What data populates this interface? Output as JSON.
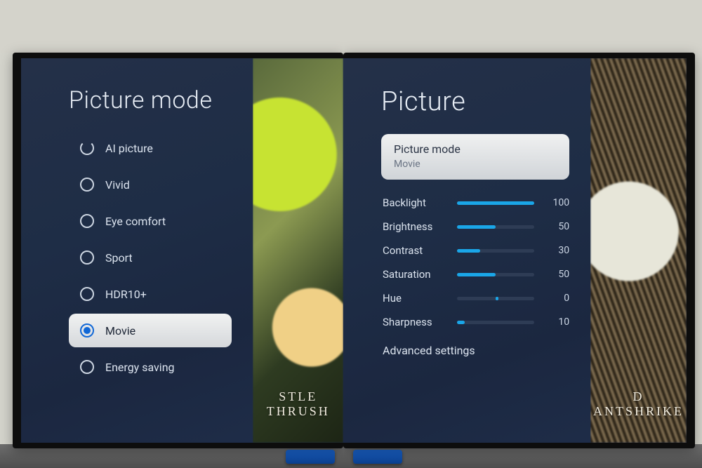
{
  "left_screen": {
    "title": "Picture mode",
    "options": [
      {
        "label": "AI picture",
        "selected": false,
        "clipped": true
      },
      {
        "label": "Vivid",
        "selected": false
      },
      {
        "label": "Eye comfort",
        "selected": false
      },
      {
        "label": "Sport",
        "selected": false
      },
      {
        "label": "HDR10+",
        "selected": false
      },
      {
        "label": "Movie",
        "selected": true
      },
      {
        "label": "Energy saving",
        "selected": false
      }
    ],
    "preview_caption": "STLE THRUSH"
  },
  "right_screen": {
    "title": "Picture",
    "mode_card": {
      "label": "Picture mode",
      "value": "Movie"
    },
    "sliders": [
      {
        "name": "Backlight",
        "value": 100,
        "max": 100
      },
      {
        "name": "Brightness",
        "value": 50,
        "max": 100
      },
      {
        "name": "Contrast",
        "value": 30,
        "max": 100
      },
      {
        "name": "Saturation",
        "value": 50,
        "max": 100
      },
      {
        "name": "Hue",
        "value": 0,
        "max": 100,
        "centered": true
      },
      {
        "name": "Sharpness",
        "value": 10,
        "max": 100
      }
    ],
    "advanced_label": "Advanced settings",
    "preview_caption": "D ANTSHRIKE"
  }
}
